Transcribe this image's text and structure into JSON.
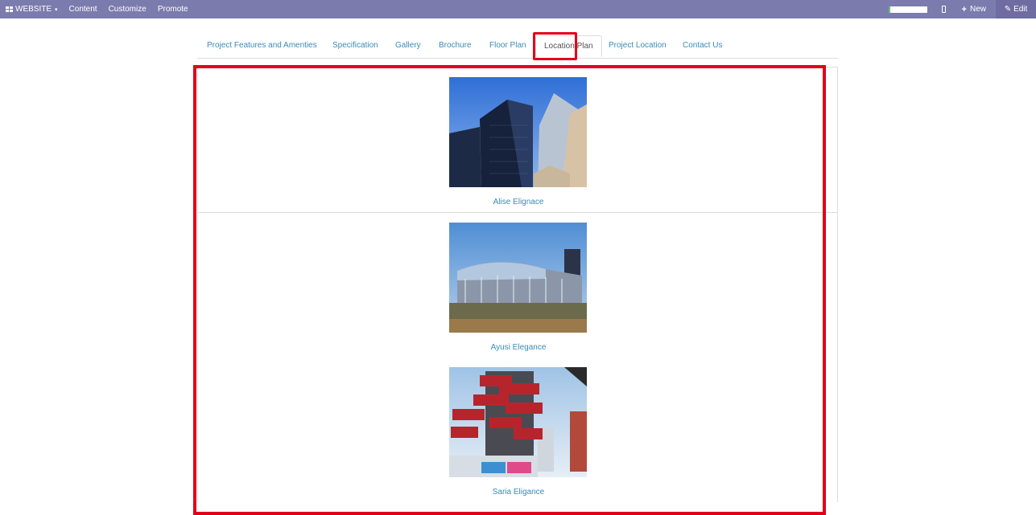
{
  "topbar": {
    "website_label": "WEBSITE",
    "menu": [
      "Content",
      "Customize",
      "Promote"
    ],
    "progress": 0.05,
    "new_label": "New",
    "edit_label": "Edit"
  },
  "tabs": [
    {
      "label": "Project Features and Amenties"
    },
    {
      "label": "Specification"
    },
    {
      "label": "Gallery"
    },
    {
      "label": "Brochure"
    },
    {
      "label": "Floor Plan"
    },
    {
      "label": "Location Plan"
    },
    {
      "label": "Project Location"
    },
    {
      "label": "Contact Us"
    }
  ],
  "active_tab": "Location Plan",
  "projects": [
    {
      "name": "Alise Elignace"
    },
    {
      "name": "Ayusi Elegance"
    },
    {
      "name": "Saria Eligance"
    }
  ],
  "colors": {
    "topbar": "#7c7bad",
    "link": "#3a8bb7",
    "highlight": "#e2001a"
  }
}
